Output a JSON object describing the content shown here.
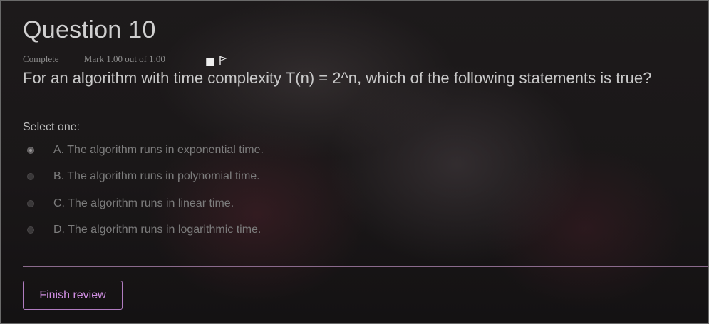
{
  "question": {
    "title": "Question 10",
    "state": "Complete",
    "mark": "Mark 1.00 out of 1.00",
    "flag_icon": "flag-icon",
    "text": "For an algorithm with time complexity T(n) = 2^n, which of the following statements is true?"
  },
  "answer": {
    "prompt": "Select one:",
    "selected_index": 0,
    "options": [
      {
        "label": "A. The algorithm runs in exponential time.",
        "checked": true
      },
      {
        "label": "B. The algorithm runs in polynomial time.",
        "checked": false
      },
      {
        "label": "C. The algorithm runs in linear time.",
        "checked": false
      },
      {
        "label": "D. The algorithm runs in logarithmic time.",
        "checked": false
      }
    ]
  },
  "actions": {
    "finish_label": "Finish review"
  },
  "colors": {
    "accent": "#d08fe3",
    "divider": "#8a6a8c"
  }
}
